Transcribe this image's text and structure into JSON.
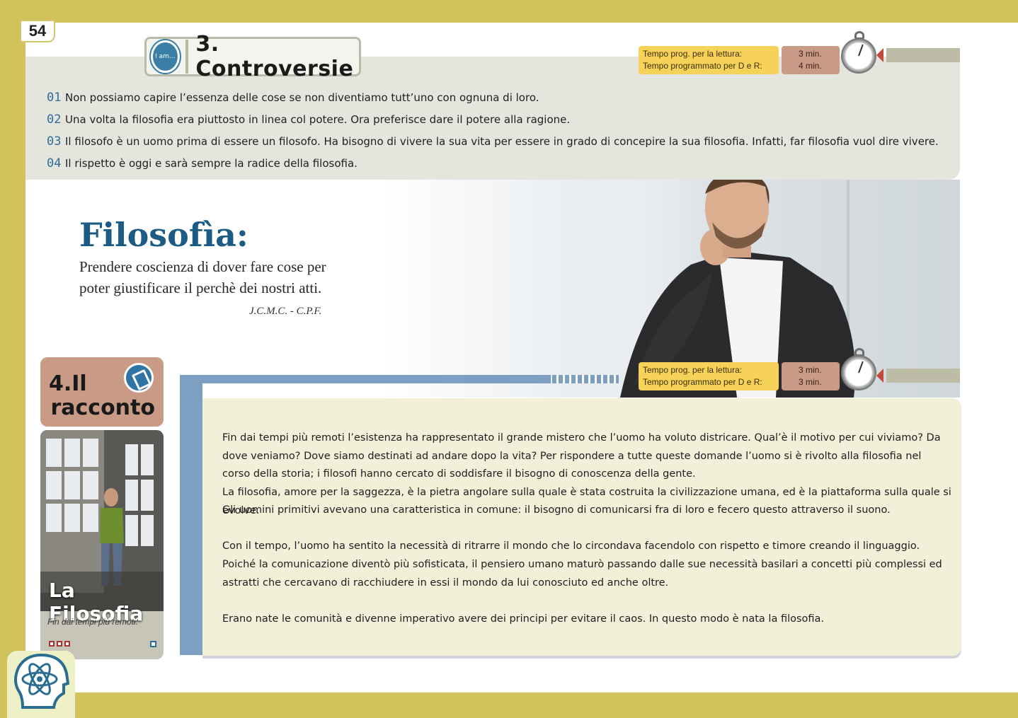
{
  "page": {
    "number": "54"
  },
  "controversie": {
    "title": "3. Controversie",
    "icon_text": "I am...",
    "items": [
      {
        "num": "01",
        "text": "Non possiamo capire l’essenza delle cose se non diventiamo tutt’uno con ognuna di loro."
      },
      {
        "num": "02",
        "text": "Una volta la filosofia era piuttosto in linea col potere. Ora preferisce dare il potere alla ragione."
      },
      {
        "num": "03",
        "text": "Il filosofo è un uomo prima di essere un filosofo. Ha bisogno di vivere la sua vita per essere in grado di concepire la sua filosofia. Infatti, far filosofia vuol dire vivere."
      },
      {
        "num": "04",
        "text": "Il rispetto è oggi e sarà sempre la radice della filosofia."
      }
    ]
  },
  "timer_top": {
    "label1": "Tempo prog. per la lettura:",
    "label2": "Tempo programmato per D e R:",
    "value1": "3 min.",
    "value2": "4 min."
  },
  "timer_bottom": {
    "label1": "Tempo prog. per la lettura:",
    "label2": "Tempo programmato per D e R:",
    "value1": "3 min.",
    "value2": "3 min."
  },
  "quote": {
    "title": "Filosofìa:",
    "line1": "Prendere coscienza di dover fare cose per",
    "line2": "poter giustificare il perchè dei nostri atti.",
    "author": "J.C.M.C. - C.P.F."
  },
  "racconto": {
    "label_line1": "4.Il",
    "label_line2": "racconto"
  },
  "card": {
    "title": "La Filosofia",
    "subtitle": "Fin dai tempi più remoti."
  },
  "story": {
    "p1": "Fin dai tempi più remoti l’esistenza ha rappresentato il grande mistero che l’uomo ha voluto districare. Qual’è il motivo per cui viviamo? Da dove veniamo? Dove siamo destinati ad andare dopo la vita? Per rispondere a tutte queste domande l’uomo si è rivolto alla filosofia nel corso della storia; i filosofi hanno cercato di soddisfare il bisogno di conoscenza della gente.",
    "p2": "La filosofia, amore per la saggezza, è la pietra angolare sulla quale è stata costruita la civilizzazione umana, ed è la piattaforma sulla quale si evolve.",
    "p3": "Gli uomini primitivi avevano una caratteristica in comune: il bisogno di comunicarsi fra di loro e fecero questo attraverso il suono.",
    "p4": "Con il tempo, l’uomo ha sentito la necessità di ritrarre il mondo che lo circondava facendolo con rispetto e timore creando il linguaggio.",
    "p5": "Poiché la comunicazione diventò più sofisticata, il pensiero umano maturò passando dalle sue necessità basilari a concetti più complessi ed astratti che cercavano di racchiudere in essi il mondo da lui conosciuto ed anche oltre.",
    "p6": "Erano nate le comunità e divenne imperativo avere dei principi per evitare il caos. In questo modo è nata la filosofia."
  },
  "colors": {
    "page_border": "#d1c25c",
    "accent_blue": "#2e6d9c",
    "timer_label": "#f6d25a",
    "timer_value": "#c99a86",
    "panel": "#e4e5dc",
    "story_bg": "#f2f0d8"
  }
}
